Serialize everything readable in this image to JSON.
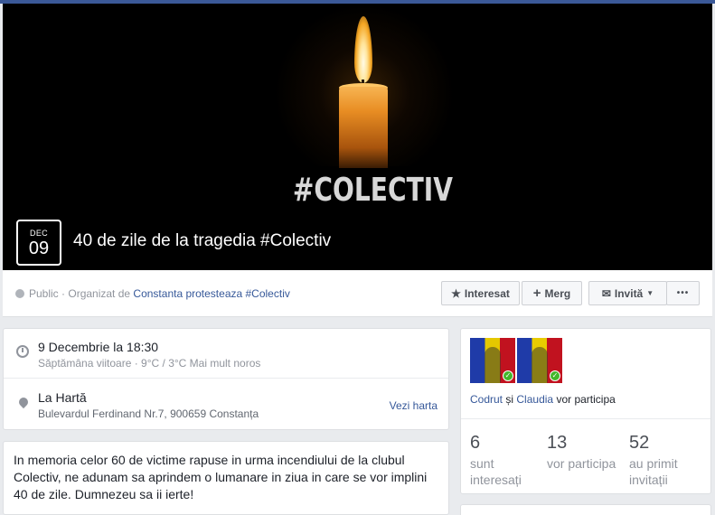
{
  "cover": {
    "image_text": "#COLECTIV",
    "date_month": "DEC",
    "date_day": "09",
    "title": "40 de zile de la tragedia #Colectiv"
  },
  "meta": {
    "privacy": "Public",
    "organized_by": "· Organizat de",
    "organizer": "Constanta protesteaza #Colectiv"
  },
  "actions": {
    "interested": "Interesat",
    "going": "Merg",
    "invite": "Invită",
    "more": "•••"
  },
  "details": {
    "datetime": "9 Decembrie la 18:30",
    "datetime_sub": "Săptămâna viitoare · 9°C / 3°C Mai mult noros",
    "place": "La Hartă",
    "address": "Bulevardul Ferdinand Nr.7, 900659 Constanța",
    "map_link": "Vezi harta"
  },
  "description": "In memoria celor 60 de victime rapuse in urma incendiului de la clubul Colectiv, ne adunam sa aprindem o lumanare in ziua in care se vor implini 40 de zile. Dumnezeu sa ii ierte!",
  "guests": {
    "name1": "Codrut",
    "and": "și",
    "name2": "Claudia",
    "going_suffix": "vor participa",
    "stats": [
      {
        "count": "6",
        "label": "sunt interesați"
      },
      {
        "count": "13",
        "label": "vor participa"
      },
      {
        "count": "52",
        "label": "au primit invitații"
      }
    ]
  },
  "colors": {
    "brand_bar": "#3b5998",
    "link": "#365899",
    "check": "#42b72a"
  },
  "icons": [
    "globe-icon",
    "star-icon",
    "plus-icon",
    "envelope-icon",
    "chevron-down-icon",
    "clock-icon",
    "map-pin-icon",
    "check-icon"
  ]
}
